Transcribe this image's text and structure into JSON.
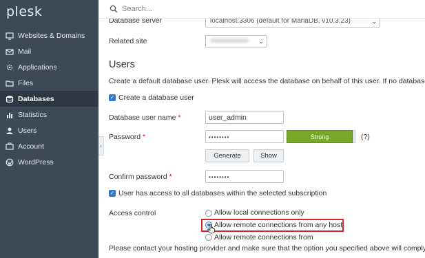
{
  "app": {
    "logo": "plesk"
  },
  "search": {
    "placeholder": "Search..."
  },
  "sidebar": {
    "items": [
      {
        "label": "Websites & Domains",
        "icon": "monitor-icon"
      },
      {
        "label": "Mail",
        "icon": "envelope-icon"
      },
      {
        "label": "Applications",
        "icon": "gear-icon"
      },
      {
        "label": "Files",
        "icon": "folder-icon"
      },
      {
        "label": "Databases",
        "icon": "database-icon",
        "active": true
      },
      {
        "label": "Statistics",
        "icon": "bar-chart-icon"
      },
      {
        "label": "Users",
        "icon": "user-icon"
      },
      {
        "label": "Account",
        "icon": "account-icon"
      },
      {
        "label": "WordPress",
        "icon": "wordpress-icon"
      }
    ],
    "collapse_glyph": "‹"
  },
  "form": {
    "db_server_label": "Database server",
    "db_server_value": "localhost:3306 (default for MariaDB, v10.3.23)",
    "related_site_label": "Related site",
    "users_heading": "Users",
    "users_desc": "Create a default database user. Plesk will access the database on behalf of this user. If no database users are",
    "create_user_label": "Create a database user",
    "username_label": "Database user name",
    "username_value": "user_admin",
    "password_label": "Password",
    "password_value": "••••••••",
    "strength_label": "Strong",
    "help_label": "(?)",
    "generate_label": "Generate",
    "show_label": "Show",
    "confirm_label": "Confirm password",
    "confirm_value": "••••••••",
    "access_all_label": "User has access to all databases within the selected subscription",
    "access_control_label": "Access control",
    "radio_local": "Allow local connections only",
    "radio_any": "Allow remote connections from any host",
    "radio_from": "Allow remote connections from",
    "footer_text": "Please contact your hosting provider and make sure that the option you specified above will comply with the",
    "required_mark": "*",
    "selected_access": "Allow remote connections from any host"
  },
  "colors": {
    "sidebar_bg": "#3c4a57",
    "accent": "#2f7ac8",
    "strength": "#79a829",
    "highlight": "#d9262c"
  }
}
